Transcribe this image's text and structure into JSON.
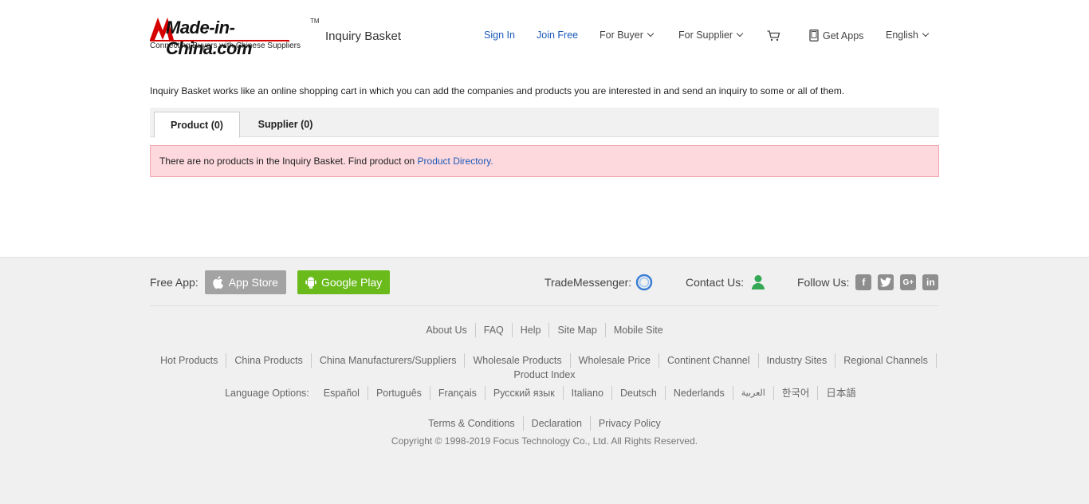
{
  "header": {
    "logo_text": "Made-in-China.com",
    "logo_tm": "TM",
    "logo_tagline": "Connecting Buyers with Chinese Suppliers",
    "page_name": "Inquiry Basket",
    "sign_in": "Sign In",
    "join_free": "Join Free",
    "for_buyer": "For Buyer",
    "for_supplier": "For Supplier",
    "get_apps": "Get Apps",
    "language": "English"
  },
  "main": {
    "intro": "Inquiry Basket works like an online shopping cart in which you can add the companies and products you are interested in and send an inquiry to some or all of them.",
    "tabs": [
      {
        "label": "Product (0)"
      },
      {
        "label": "Supplier (0)"
      }
    ],
    "notice_text": "There are no products in the Inquiry Basket. Find product on ",
    "notice_link": "Product Directory."
  },
  "footer": {
    "free_app_label": "Free App:",
    "app_store": "App Store",
    "google_play": "Google Play",
    "trade_messenger_label": "TradeMessenger:",
    "contact_label": "Contact Us:",
    "follow_label": "Follow Us:",
    "social_icons": [
      "facebook-icon",
      "twitter-icon",
      "google-plus-icon",
      "linkedin-icon"
    ],
    "links_row1": [
      "About Us",
      "FAQ",
      "Help",
      "Site Map",
      "Mobile Site"
    ],
    "links_row2": [
      "Hot Products",
      "China Products",
      "China Manufacturers/Suppliers",
      "Wholesale Products",
      "Wholesale Price",
      "Continent Channel",
      "Industry Sites",
      "Regional Channels",
      "Product Index"
    ],
    "language_label": "Language Options:",
    "languages": [
      "Español",
      "Português",
      "Français",
      "Русский язык",
      "Italiano",
      "Deutsch",
      "Nederlands",
      "العربية",
      "한국어",
      "日本語"
    ],
    "links_legal": [
      "Terms & Conditions",
      "Declaration",
      "Privacy Policy"
    ],
    "copyright": "Copyright © 1998-2019 Focus Technology Co., Ltd. All Rights Reserved."
  },
  "colors": {
    "link_blue": "#1d5ab8",
    "brand_red": "#d60000",
    "notice_bg": "#fdd9dd",
    "google_play_green": "#6aba1c",
    "app_store_gray": "#a3a3a3"
  }
}
